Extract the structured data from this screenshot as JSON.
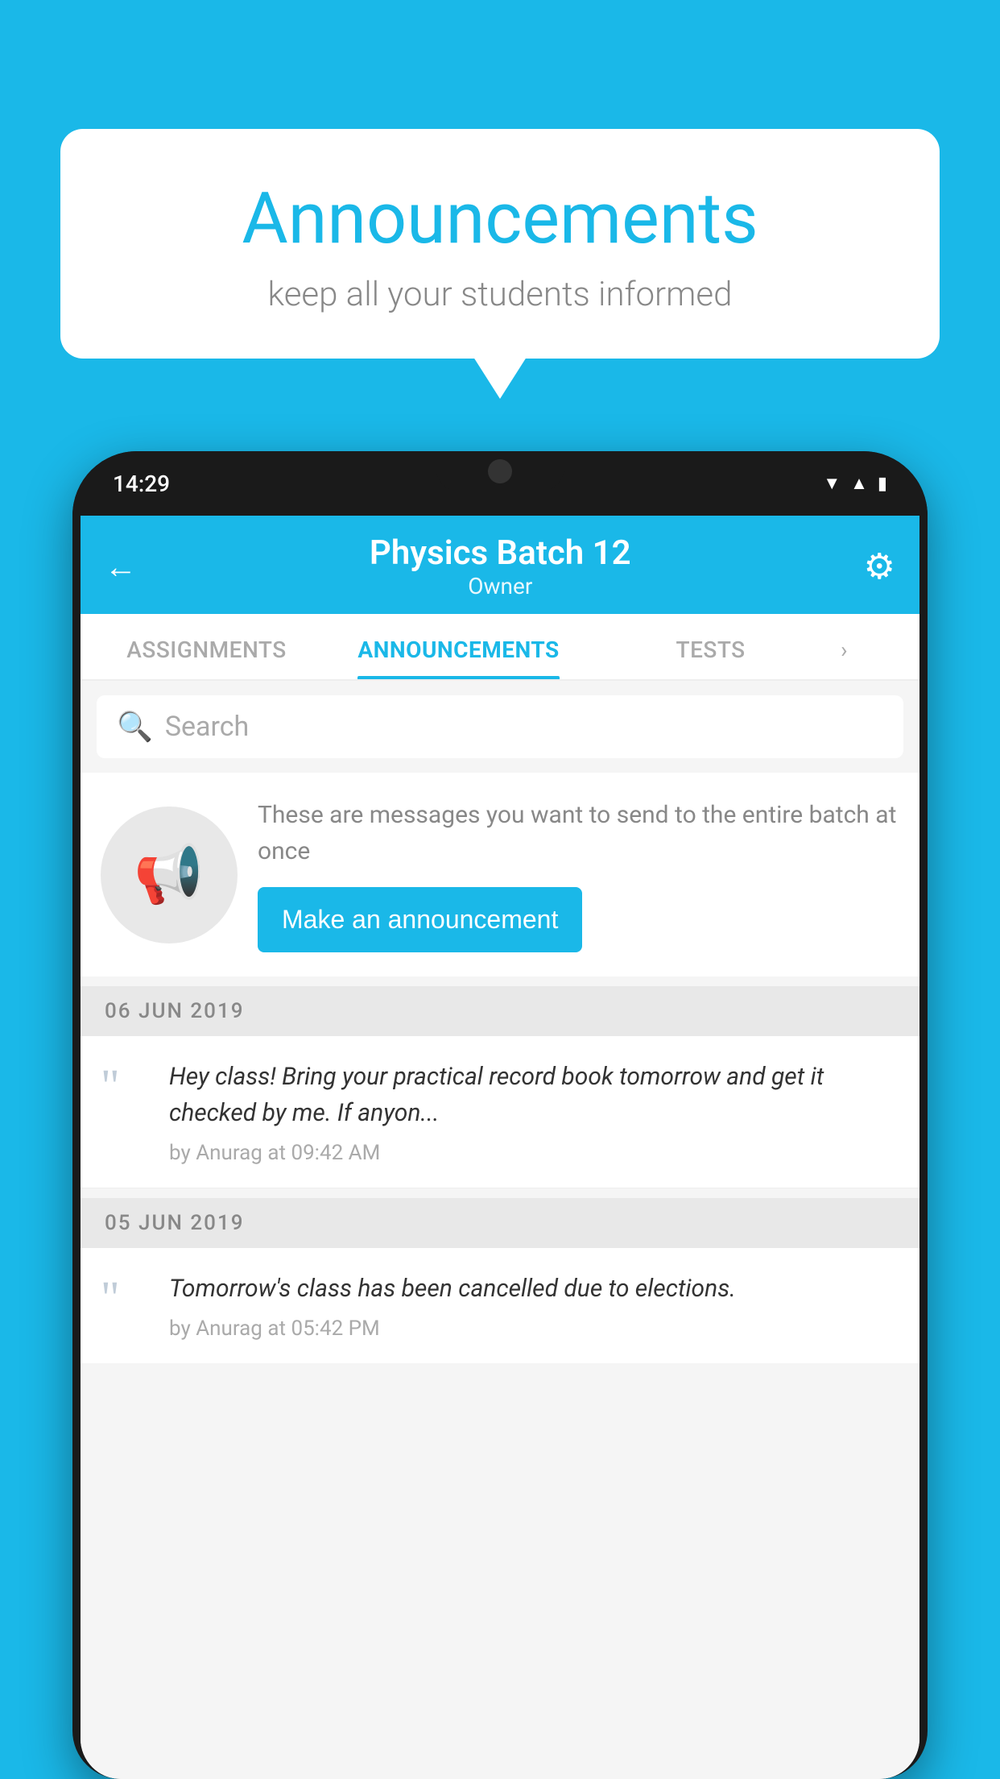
{
  "bubble": {
    "title": "Announcements",
    "subtitle": "keep all your students informed"
  },
  "phone": {
    "status_time": "14:29",
    "header": {
      "title": "Physics Batch 12",
      "subtitle": "Owner",
      "back_label": "←",
      "settings_label": "⚙"
    },
    "tabs": [
      {
        "label": "ASSIGNMENTS",
        "active": false
      },
      {
        "label": "ANNOUNCEMENTS",
        "active": true
      },
      {
        "label": "TESTS",
        "active": false
      }
    ],
    "search": {
      "placeholder": "Search"
    },
    "promo": {
      "description": "These are messages you want to send to the entire batch at once",
      "button_label": "Make an announcement"
    },
    "announcements": [
      {
        "date": "06  JUN  2019",
        "text": "Hey class! Bring your practical record book tomorrow and get it checked by me. If anyon...",
        "meta": "by Anurag at 09:42 AM"
      },
      {
        "date": "05  JUN  2019",
        "text": "Tomorrow's class has been cancelled due to elections.",
        "meta": "by Anurag at 05:42 PM"
      }
    ]
  },
  "colors": {
    "primary": "#1ab8e8",
    "text_dark": "#333",
    "text_muted": "#888",
    "bg_light": "#f5f5f5"
  }
}
